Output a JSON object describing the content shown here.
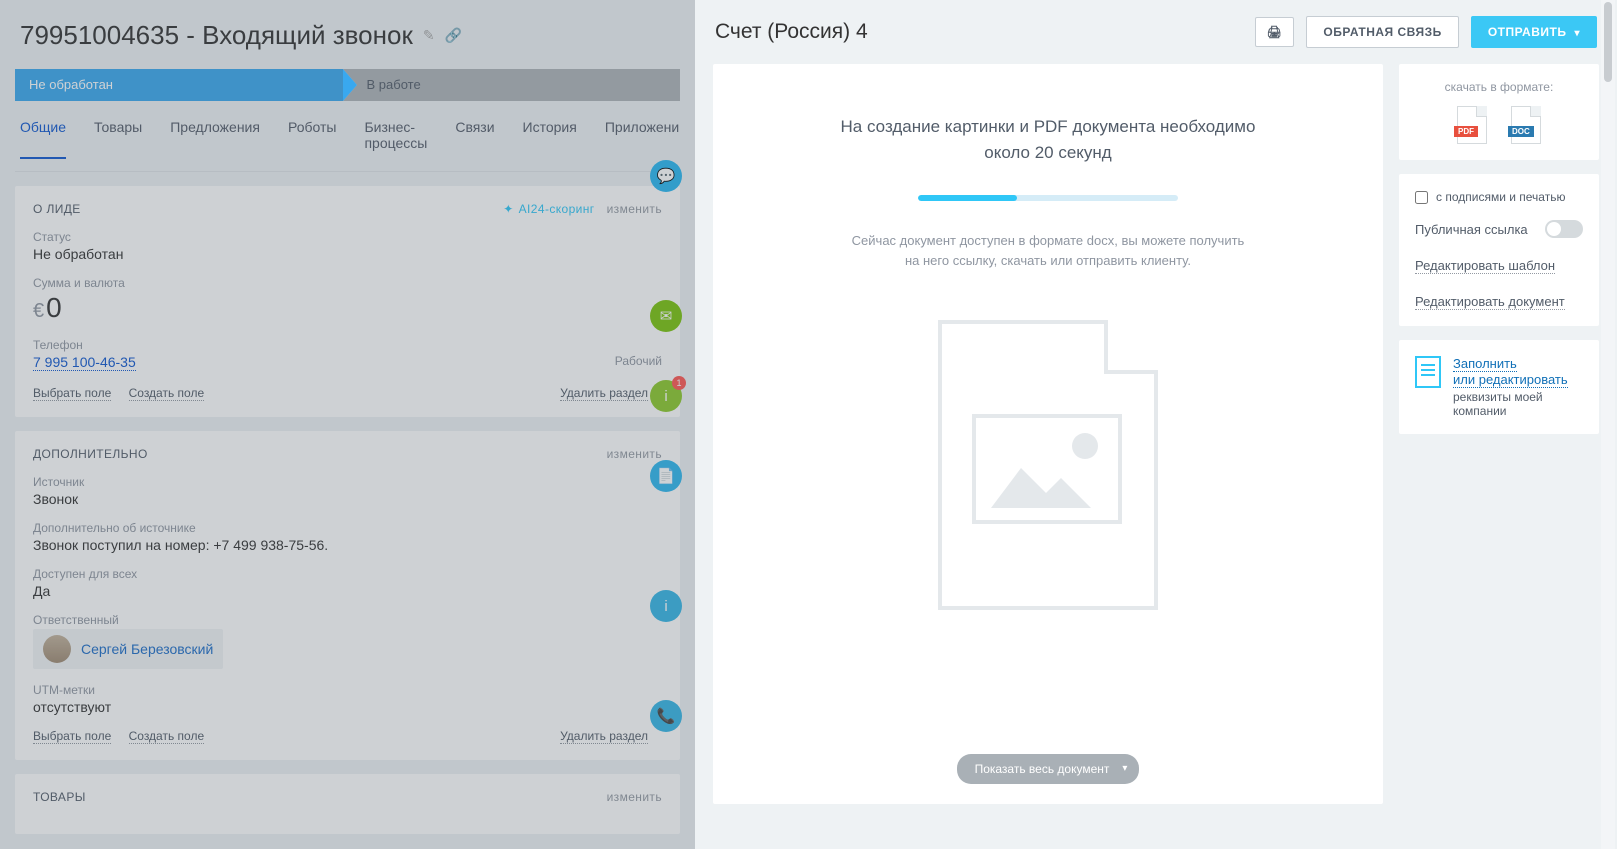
{
  "lead": {
    "title": "79951004635 - Входящий звонок",
    "stages": {
      "active": "Не обработан",
      "next": "В работе"
    },
    "tabs": [
      "Общие",
      "Товары",
      "Предложения",
      "Роботы",
      "Бизнес-процессы",
      "Связи",
      "История",
      "Приложени"
    ],
    "about": {
      "heading": "О ЛИДЕ",
      "scoring": "AI24-скоринг",
      "edit": "изменить",
      "status_label": "Статус",
      "status_value": "Не обработан",
      "amount_label": "Сумма и валюта",
      "amount_currency": "€",
      "amount_value": "0",
      "phone_label": "Телефон",
      "phone_value": "7 995 100-46-35",
      "phone_type": "Рабочий",
      "select_field": "Выбрать поле",
      "create_field": "Создать поле",
      "delete_section": "Удалить раздел"
    },
    "extra": {
      "heading": "ДОПОЛНИТЕЛЬНО",
      "edit": "изменить",
      "source_label": "Источник",
      "source_value": "Звонок",
      "source_detail_label": "Дополнительно об источнике",
      "source_detail_value": "Звонок поступил на номер: +7 499 938-75-56.",
      "public_label": "Доступен для всех",
      "public_value": "Да",
      "responsible_label": "Ответственный",
      "responsible_value": "Сергей Березовский",
      "utm_label": "UTM-метки",
      "utm_value": "отсутствуют",
      "select_field": "Выбрать поле",
      "create_field": "Создать поле",
      "delete_section": "Удалить раздел"
    },
    "products": {
      "heading": "ТОВАРЫ",
      "edit": "изменить"
    },
    "timeline_badge": "1"
  },
  "doc": {
    "title": "Счет (Россия) 4",
    "btn_feedback": "ОБРАТНАЯ СВЯЗЬ",
    "btn_send": "ОТПРАВИТЬ",
    "msg_line1": "На создание картинки и PDF документа необходимо",
    "msg_line2": "около 20 секунд",
    "sub_line1": "Сейчас документ доступен в формате docx, вы можете получить",
    "sub_line2": "на него ссылку, скачать или отправить клиенту.",
    "show_all": "Показать весь документ",
    "download_title": "скачать в формате:",
    "pdf": "PDF",
    "docx": "DOC",
    "signatures": "с подписями и печатью",
    "public_link": "Публичная ссылка",
    "edit_template": "Редактировать шаблон",
    "edit_document": "Редактировать документ",
    "req_fill": "Заполнить",
    "req_edit": "или редактировать",
    "req_sub": "реквизиты моей компании"
  }
}
